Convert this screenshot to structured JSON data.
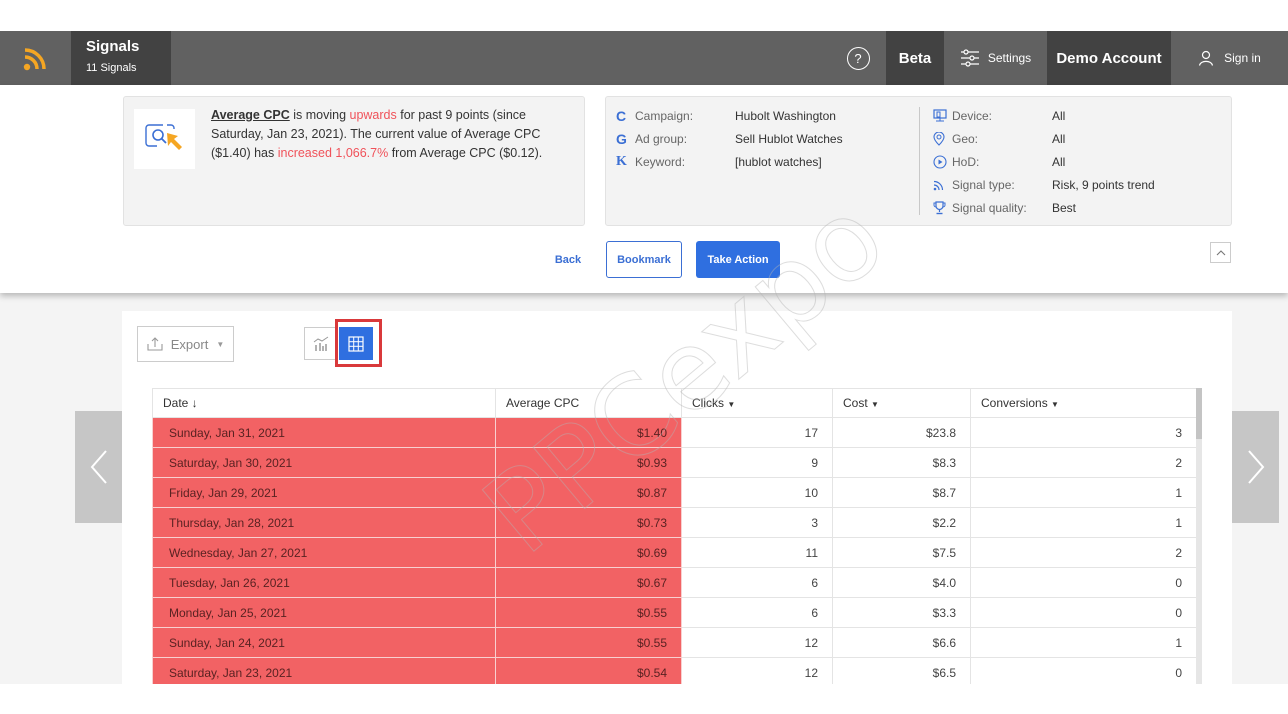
{
  "nav": {
    "title": "Signals",
    "subtitle": "11 Signals",
    "help_label": "?",
    "beta_label": "Beta",
    "settings_label": "Settings",
    "account_label": "Demo Account",
    "signin_label": "Sign in",
    "logo_color": "#f5a623"
  },
  "signal": {
    "metric": "Average CPC",
    "text_1": " is moving ",
    "direction": "upwards",
    "text_2": " for past 9 points (since Saturday, Jan 23, 2021). The current value of Average CPC ($1.40) has ",
    "change": "increased 1,066.7%",
    "text_3": " from Average CPC ($0.12)."
  },
  "meta_left": [
    {
      "icon": "C",
      "label": "Campaign:",
      "value": "Hubolt Washington"
    },
    {
      "icon": "G",
      "label": "Ad group:",
      "value": "Sell Hublot Watches"
    },
    {
      "icon": "K",
      "label": "Keyword:",
      "value": "[hublot watches]"
    }
  ],
  "meta_right": [
    {
      "icon": "device-icon",
      "label": "Device:",
      "value": "All"
    },
    {
      "icon": "geo-pin-icon",
      "label": "Geo:",
      "value": "All"
    },
    {
      "icon": "clock-play-icon",
      "label": "HoD:",
      "value": "All"
    },
    {
      "icon": "signal-icon",
      "label": "Signal type:",
      "value": "Risk, 9 points trend"
    },
    {
      "icon": "trophy-icon",
      "label": "Signal quality:",
      "value": "Best"
    }
  ],
  "actions": {
    "back": "Back",
    "bookmark": "Bookmark",
    "take_action": "Take Action"
  },
  "toolbar": {
    "export": "Export"
  },
  "watermark": "PPCexpo",
  "table": {
    "headers": [
      "Date ↓",
      "Average CPC",
      "Clicks",
      "Cost",
      "Conversions"
    ],
    "rows": [
      [
        "Sunday, Jan 31, 2021",
        "$1.40",
        "17",
        "$23.8",
        "3"
      ],
      [
        "Saturday, Jan 30, 2021",
        "$0.93",
        "9",
        "$8.3",
        "2"
      ],
      [
        "Friday, Jan 29, 2021",
        "$0.87",
        "10",
        "$8.7",
        "1"
      ],
      [
        "Thursday, Jan 28, 2021",
        "$0.73",
        "3",
        "$2.2",
        "1"
      ],
      [
        "Wednesday, Jan 27, 2021",
        "$0.69",
        "11",
        "$7.5",
        "2"
      ],
      [
        "Tuesday, Jan 26, 2021",
        "$0.67",
        "6",
        "$4.0",
        "0"
      ],
      [
        "Monday, Jan 25, 2021",
        "$0.55",
        "6",
        "$3.3",
        "0"
      ],
      [
        "Sunday, Jan 24, 2021",
        "$0.55",
        "12",
        "$6.6",
        "1"
      ],
      [
        "Saturday, Jan 23, 2021",
        "$0.54",
        "12",
        "$6.5",
        "0"
      ]
    ]
  }
}
